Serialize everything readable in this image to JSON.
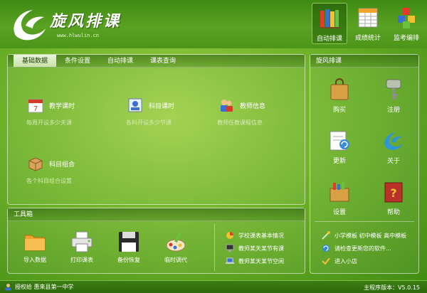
{
  "app": {
    "title": "旋风排课",
    "url": "www.hlwulin.cn"
  },
  "topnav": [
    {
      "label": "自动排课",
      "icon": "books-icon",
      "active": true
    },
    {
      "label": "成绩统计",
      "icon": "spreadsheet-icon",
      "active": false
    },
    {
      "label": "监考编排",
      "icon": "cubes-icon",
      "active": false
    }
  ],
  "tabs": [
    "基础数据",
    "条件设置",
    "自动排课",
    "课表查询"
  ],
  "features": [
    {
      "title": "教学课时",
      "sub": "每周开设多少天课",
      "icon": "calendar-icon"
    },
    {
      "title": "科目课时",
      "sub": "各科开设多少节课",
      "icon": "subject-icon"
    },
    {
      "title": "教师信息",
      "sub": "教师任教课程信息",
      "icon": "teachers-icon"
    },
    {
      "title": "科目组合",
      "sub": "各个科目组合设置",
      "icon": "package-icon"
    }
  ],
  "tools_panel": {
    "title": "工具箱",
    "tools": [
      {
        "label": "导入数据",
        "icon": "folder-icon"
      },
      {
        "label": "打印课表",
        "icon": "printer-icon"
      },
      {
        "label": "备份恢复",
        "icon": "floppy-icon"
      },
      {
        "label": "临时调代",
        "icon": "paint-icon"
      }
    ],
    "links": [
      {
        "label": "学校课表基本情况",
        "icon": "pie-chart-icon"
      },
      {
        "label": "教师某天某节有课",
        "icon": "monitor-icon"
      },
      {
        "label": "教师某天某节空闲",
        "icon": "laptop-icon"
      }
    ]
  },
  "right_panel": {
    "title": "旋风排课",
    "items": [
      {
        "label": "购买",
        "icon": "shopping-bag-icon"
      },
      {
        "label": "注册",
        "icon": "key-icon"
      },
      {
        "label": "更新",
        "icon": "update-icon"
      },
      {
        "label": "关于",
        "icon": "logo-swirl-icon"
      },
      {
        "label": "设置",
        "icon": "settings-box-icon"
      },
      {
        "label": "帮助",
        "icon": "help-book-icon"
      }
    ],
    "links": [
      {
        "label": "小学模板 初中模板 高中模板",
        "icon": "template-icon"
      },
      {
        "label": "请检查更新您的软件...",
        "icon": "refresh-icon"
      },
      {
        "label": "进入小店",
        "icon": "checkmark-icon"
      }
    ]
  },
  "status": {
    "license": "授权给 惠来县第一中学",
    "version": "主程序版本：V5.0.15"
  },
  "colors": {
    "background": "#6fb22a",
    "header": "#4d9519",
    "tab_active": "#eaf3dc"
  }
}
